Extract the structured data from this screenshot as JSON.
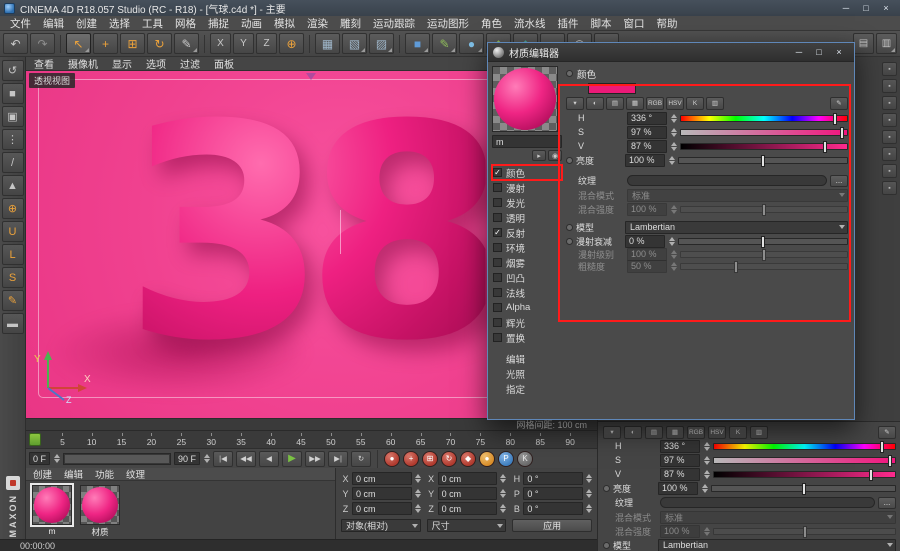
{
  "colors": {
    "accent_orange": "#eca23b",
    "viewport_pink": "#f0418f",
    "material_magenta": "#ef2584",
    "highlight_red": "#ff1a1a",
    "play_green": "#7ac143",
    "dialog_focus_blue": "#5f87b8"
  },
  "titlebar": {
    "title": "CINEMA 4D R18.057 Studio (RC - R18) - [气球.c4d *] - 主要",
    "minimize": "─",
    "maximize": "□",
    "close": "×"
  },
  "menubar": {
    "items": [
      "文件",
      "编辑",
      "创建",
      "选择",
      "工具",
      "网格",
      "捕捉",
      "动画",
      "模拟",
      "渲染",
      "雕刻",
      "运动跟踪",
      "运动图形",
      "角色",
      "流水线",
      "插件",
      "脚本",
      "窗口",
      "帮助"
    ]
  },
  "toolbar": {
    "icons": [
      {
        "name": "undo",
        "glyph": "↶"
      },
      {
        "name": "redo",
        "glyph": "↷"
      },
      {
        "name": "live-selection",
        "glyph": "↖"
      },
      {
        "name": "move",
        "glyph": "+"
      },
      {
        "name": "scale",
        "glyph": "⊞"
      },
      {
        "name": "rotate",
        "glyph": "↻"
      },
      {
        "name": "last-tool",
        "glyph": "✎"
      },
      {
        "name": "lock-x-axis",
        "glyph": "X"
      },
      {
        "name": "lock-y-axis",
        "glyph": "Y"
      },
      {
        "name": "lock-z-axis",
        "glyph": "Z"
      },
      {
        "name": "coordinate-system",
        "glyph": "⊕"
      },
      {
        "name": "render-view",
        "glyph": "▦"
      },
      {
        "name": "render-to-picture-viewer",
        "glyph": "▧"
      },
      {
        "name": "render-settings",
        "glyph": "▨"
      },
      {
        "name": "add-cube-primitive",
        "glyph": "■"
      },
      {
        "name": "add-spline-pen",
        "glyph": "✎"
      },
      {
        "name": "subdivision-surface",
        "glyph": "●"
      },
      {
        "name": "add-array",
        "glyph": "◆"
      },
      {
        "name": "add-boole",
        "glyph": "◆"
      },
      {
        "name": "add-floor",
        "glyph": "▬"
      },
      {
        "name": "add-camera",
        "glyph": "◉"
      },
      {
        "name": "add-light",
        "glyph": "●"
      }
    ]
  },
  "interface_switch": {
    "icons": [
      {
        "name": "interface-layout-a",
        "glyph": "▤"
      },
      {
        "name": "interface-layout-b",
        "glyph": "▥"
      }
    ]
  },
  "left_toolbar": {
    "icons": [
      {
        "name": "make-editable",
        "glyph": "↺"
      },
      {
        "name": "model-mode",
        "glyph": "■"
      },
      {
        "name": "texture-mode",
        "glyph": "▣"
      },
      {
        "name": "point-mode",
        "glyph": "⋮"
      },
      {
        "name": "edge-mode",
        "glyph": "/"
      },
      {
        "name": "polygon-mode",
        "glyph": "▲"
      },
      {
        "name": "axis-mode",
        "glyph": "⊕"
      },
      {
        "name": "snap-magnet",
        "glyph": "U"
      },
      {
        "name": "lock-axis",
        "glyph": "L"
      },
      {
        "name": "solo-mode",
        "glyph": "S"
      },
      {
        "name": "paint-tool",
        "glyph": "✎"
      },
      {
        "name": "workplane",
        "glyph": "▬"
      }
    ]
  },
  "viewport": {
    "menu": [
      "查看",
      "摄像机",
      "显示",
      "选项",
      "过滤",
      "面板"
    ],
    "view_label": "透视视图",
    "object_text": "38",
    "grid_spacing": "网格间距: 100 cm",
    "axis": {
      "x": "X",
      "y": "Y",
      "z": "Z"
    }
  },
  "timeline": {
    "ticks": [
      "0",
      "5",
      "10",
      "15",
      "20",
      "25",
      "30",
      "35",
      "40",
      "45",
      "50",
      "55",
      "60",
      "65",
      "70",
      "75",
      "80",
      "85",
      "90"
    ]
  },
  "transport": {
    "start_frame": "0 F",
    "end_frame": "90 F",
    "buttons": [
      {
        "name": "go-to-start",
        "glyph": "|◀"
      },
      {
        "name": "previous-key",
        "glyph": "◀◀"
      },
      {
        "name": "previous-frame",
        "glyph": "◀"
      },
      {
        "name": "play-forward",
        "glyph": "▶"
      },
      {
        "name": "next-frame",
        "glyph": "▶▶"
      },
      {
        "name": "go-to-end",
        "glyph": "▶|"
      },
      {
        "name": "play-mode",
        "glyph": "↻"
      }
    ],
    "record_buttons": [
      {
        "name": "record-active-objects",
        "glyph": "●"
      },
      {
        "name": "record-position",
        "glyph": "+"
      },
      {
        "name": "record-scale",
        "glyph": "⊞"
      },
      {
        "name": "record-rotation",
        "glyph": "↻"
      },
      {
        "name": "record-parameter",
        "glyph": "◆"
      },
      {
        "name": "auto-keying",
        "glyph": "●"
      },
      {
        "name": "record-point-level",
        "glyph": "P"
      },
      {
        "name": "keyframe-selection",
        "glyph": "K"
      }
    ]
  },
  "materials_panel": {
    "menu": [
      "创建",
      "编辑",
      "功能",
      "纹理"
    ],
    "items": [
      {
        "label": "m"
      },
      {
        "label": "材质"
      }
    ]
  },
  "coordinates_panel": {
    "position": {
      "x_label": "X",
      "x_value": "0 cm",
      "y_label": "Y",
      "y_value": "0 cm",
      "z_label": "Z",
      "z_value": "0 cm"
    },
    "size": {
      "x_label": "X",
      "x_value": "0 cm",
      "y_label": "Y",
      "y_value": "0 cm",
      "z_label": "Z",
      "z_value": "0 cm"
    },
    "rotation": {
      "h_label": "H",
      "h_value": "0 °",
      "p_label": "P",
      "p_value": "0 °",
      "b_label": "B",
      "b_value": "0 °"
    },
    "mode": "对象(相对)",
    "mode2": "尺寸",
    "apply_label": "应用"
  },
  "material_editor": {
    "title": "材质编辑器",
    "minimize": "─",
    "maximize": "□",
    "close": "×",
    "material_name": "m",
    "nav_icons": [
      {
        "name": "preview-nav",
        "glyph": "▸"
      },
      {
        "name": "preview-options",
        "glyph": "◉"
      }
    ],
    "channels": [
      {
        "label": "颜色",
        "check": "✓"
      },
      {
        "label": "漫射",
        "check": ""
      },
      {
        "label": "发光",
        "check": ""
      },
      {
        "label": "透明",
        "check": ""
      },
      {
        "label": "反射",
        "check": "✓"
      },
      {
        "label": "环境",
        "check": ""
      },
      {
        "label": "烟雾",
        "check": ""
      },
      {
        "label": "凹凸",
        "check": ""
      },
      {
        "label": "法线",
        "check": ""
      },
      {
        "label": "Alpha",
        "check": ""
      },
      {
        "label": "辉光",
        "check": ""
      },
      {
        "label": "置换",
        "check": ""
      }
    ],
    "extra_items": [
      "编辑",
      "光照",
      "指定"
    ],
    "icon_row": [
      {
        "name": "compact-mode-icon",
        "glyph": "▾"
      },
      {
        "name": "color-wheel-icon",
        "glyph": "◐"
      },
      {
        "name": "spectrum-icon",
        "glyph": "▤"
      },
      {
        "name": "image-color-icon",
        "glyph": "▦"
      },
      {
        "name": "rgb-mode-icon",
        "glyph": "RGB"
      },
      {
        "name": "hsv-mode-icon",
        "glyph": "HSV"
      },
      {
        "name": "kelvin-mode-icon",
        "glyph": "K"
      },
      {
        "name": "swatches-icon",
        "glyph": "▥"
      },
      {
        "name": "eyedropper-icon",
        "glyph": "✎"
      }
    ],
    "color_panel": {
      "header": "颜色",
      "swatch_color": "#ec1a78",
      "h_label": "H",
      "h_value": "336 °",
      "s_label": "S",
      "s_value": "97 %",
      "v_label": "V",
      "v_value": "87 %",
      "brightness_label": "亮度",
      "brightness_value": "100 %",
      "texture_label": "纹理",
      "texture_browse": "...",
      "mix_mode_label": "混合模式",
      "mix_mode_value": "标准",
      "mix_strength_label": "混合强度",
      "mix_strength_value": "100 %",
      "model_label": "模型",
      "model_value": "Lambertian",
      "falloff_label": "漫射衰减",
      "falloff_value": "0 %",
      "level_label": "漫射级别",
      "level_value": "100 %",
      "roughness_label": "粗糙度",
      "roughness_value": "50 %"
    }
  },
  "attribute_manager": {
    "icon_row": [
      {
        "name": "compact-mode-icon",
        "glyph": "▾"
      },
      {
        "name": "color-wheel-icon",
        "glyph": "◐"
      },
      {
        "name": "spectrum-icon",
        "glyph": "▤"
      },
      {
        "name": "image-color-icon",
        "glyph": "▦"
      },
      {
        "name": "rgb-mode-icon",
        "glyph": "RGB"
      },
      {
        "name": "hsv-mode-icon",
        "glyph": "HSV"
      },
      {
        "name": "kelvin-mode-icon",
        "glyph": "K"
      },
      {
        "name": "swatches-icon",
        "glyph": "▥"
      },
      {
        "name": "eyedropper-icon",
        "glyph": "✎"
      }
    ],
    "h_label": "H",
    "h_value": "336 °",
    "s_label": "S",
    "s_value": "97 %",
    "v_label": "V",
    "v_value": "87 %",
    "brightness_label": "亮度",
    "brightness_value": "100 %",
    "texture_label": "纹理",
    "texture_browse": "...",
    "mix_mode_label": "混合模式",
    "mix_mode_value": "标准",
    "mix_strength_label": "混合强度",
    "mix_strength_value": "100 %",
    "model_label": "模型",
    "model_value": "Lambertian"
  },
  "right_strip": {
    "icon_glyph": "▪"
  },
  "status": {
    "time": "00:00:00"
  },
  "brand": {
    "name": "MAXON"
  }
}
